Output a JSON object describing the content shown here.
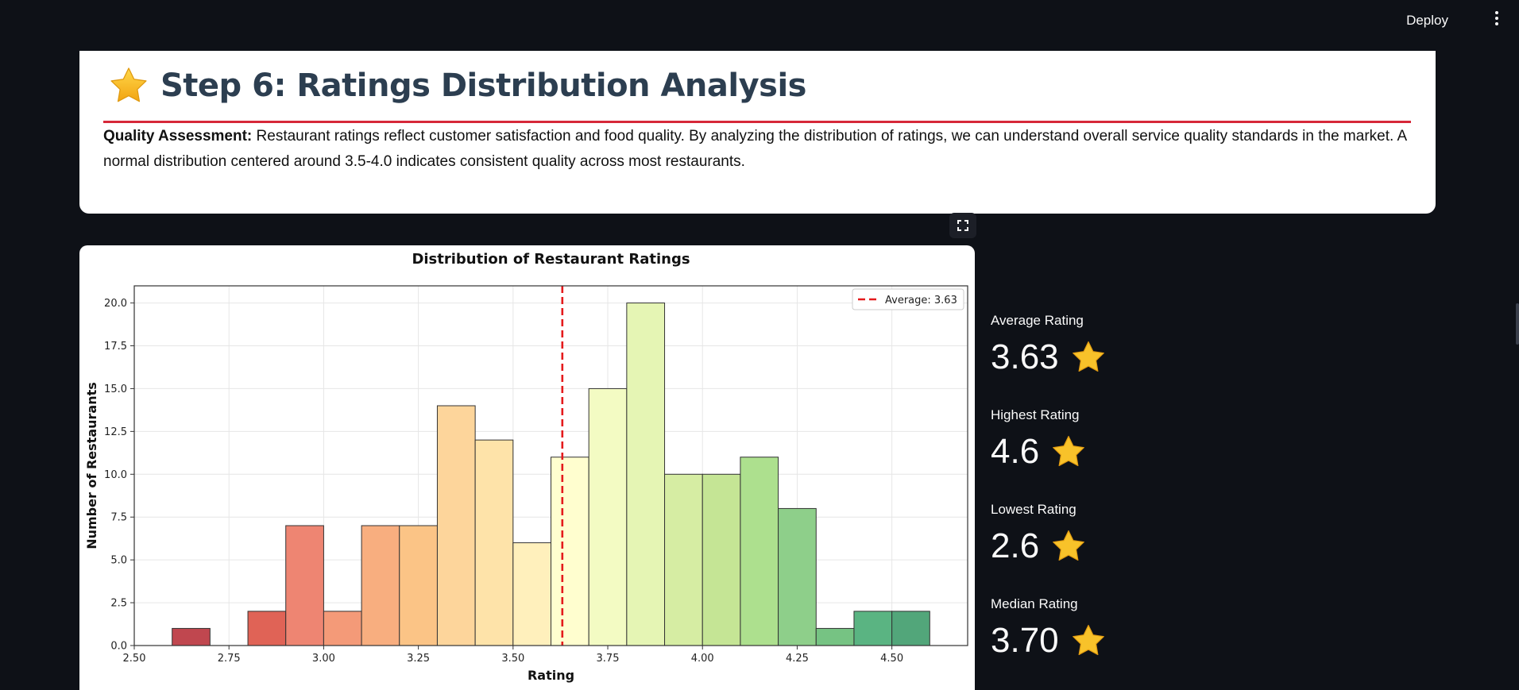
{
  "topbar": {
    "deploy_label": "Deploy"
  },
  "header": {
    "icon": "star-icon",
    "title": "Step 6: Ratings Distribution Analysis",
    "description_bold": "Quality Assessment:",
    "description_text": " Restaurant ratings reflect customer satisfaction and food quality. By analyzing the distribution of ratings, we can understand overall service quality standards in the market. A normal distribution centered around 3.5-4.0 indicates consistent quality across most restaurants."
  },
  "metrics": [
    {
      "label": "Average Rating",
      "value": "3.63",
      "icon": "star-icon"
    },
    {
      "label": "Highest Rating",
      "value": "4.6",
      "icon": "star-icon"
    },
    {
      "label": "Lowest Rating",
      "value": "2.6",
      "icon": "star-icon"
    },
    {
      "label": "Median Rating",
      "value": "3.70",
      "icon": "star-icon"
    }
  ],
  "colors": {
    "accent_rule": "#d62839",
    "title": "#2c3e50",
    "mean_line": "#e41a1c",
    "background": "#0e1117"
  },
  "chart_data": {
    "type": "bar",
    "title": "Distribution of Restaurant Ratings",
    "xlabel": "Rating",
    "ylabel": "Number of Restaurants",
    "xlim": [
      2.5,
      4.7
    ],
    "ylim": [
      0,
      21
    ],
    "xticks": [
      "2.50",
      "2.75",
      "3.00",
      "3.25",
      "3.50",
      "3.75",
      "4.00",
      "4.25",
      "4.50"
    ],
    "yticks": [
      "0.0",
      "2.5",
      "5.0",
      "7.5",
      "10.0",
      "12.5",
      "15.0",
      "17.5",
      "20.0"
    ],
    "grid": true,
    "legend_position": "top-right",
    "legend": "Average: 3.63",
    "mean": 3.63,
    "bin_width": 0.1,
    "bins": [
      {
        "x0": 2.6,
        "value": 1,
        "color": "#c0474f"
      },
      {
        "x0": 2.7,
        "value": 0,
        "color": "#d05553"
      },
      {
        "x0": 2.8,
        "value": 2,
        "color": "#e06356"
      },
      {
        "x0": 2.9,
        "value": 7,
        "color": "#ee8572"
      },
      {
        "x0": 3.0,
        "value": 2,
        "color": "#f49a78"
      },
      {
        "x0": 3.1,
        "value": 7,
        "color": "#f8ae7f"
      },
      {
        "x0": 3.2,
        "value": 7,
        "color": "#fbc486"
      },
      {
        "x0": 3.3,
        "value": 14,
        "color": "#fdd59b"
      },
      {
        "x0": 3.4,
        "value": 12,
        "color": "#fee3a9"
      },
      {
        "x0": 3.5,
        "value": 6,
        "color": "#fff0bc"
      },
      {
        "x0": 3.6,
        "value": 11,
        "color": "#fffecf"
      },
      {
        "x0": 3.7,
        "value": 15,
        "color": "#f3fbc3"
      },
      {
        "x0": 3.8,
        "value": 20,
        "color": "#e5f5b4"
      },
      {
        "x0": 3.9,
        "value": 10,
        "color": "#d6eda3"
      },
      {
        "x0": 4.0,
        "value": 10,
        "color": "#c5e595"
      },
      {
        "x0": 4.1,
        "value": 11,
        "color": "#ade08e"
      },
      {
        "x0": 4.2,
        "value": 8,
        "color": "#8ecf8a"
      },
      {
        "x0": 4.3,
        "value": 1,
        "color": "#76c383"
      },
      {
        "x0": 4.4,
        "value": 2,
        "color": "#5ab482"
      },
      {
        "x0": 4.5,
        "value": 2,
        "color": "#52a67a"
      }
    ]
  }
}
